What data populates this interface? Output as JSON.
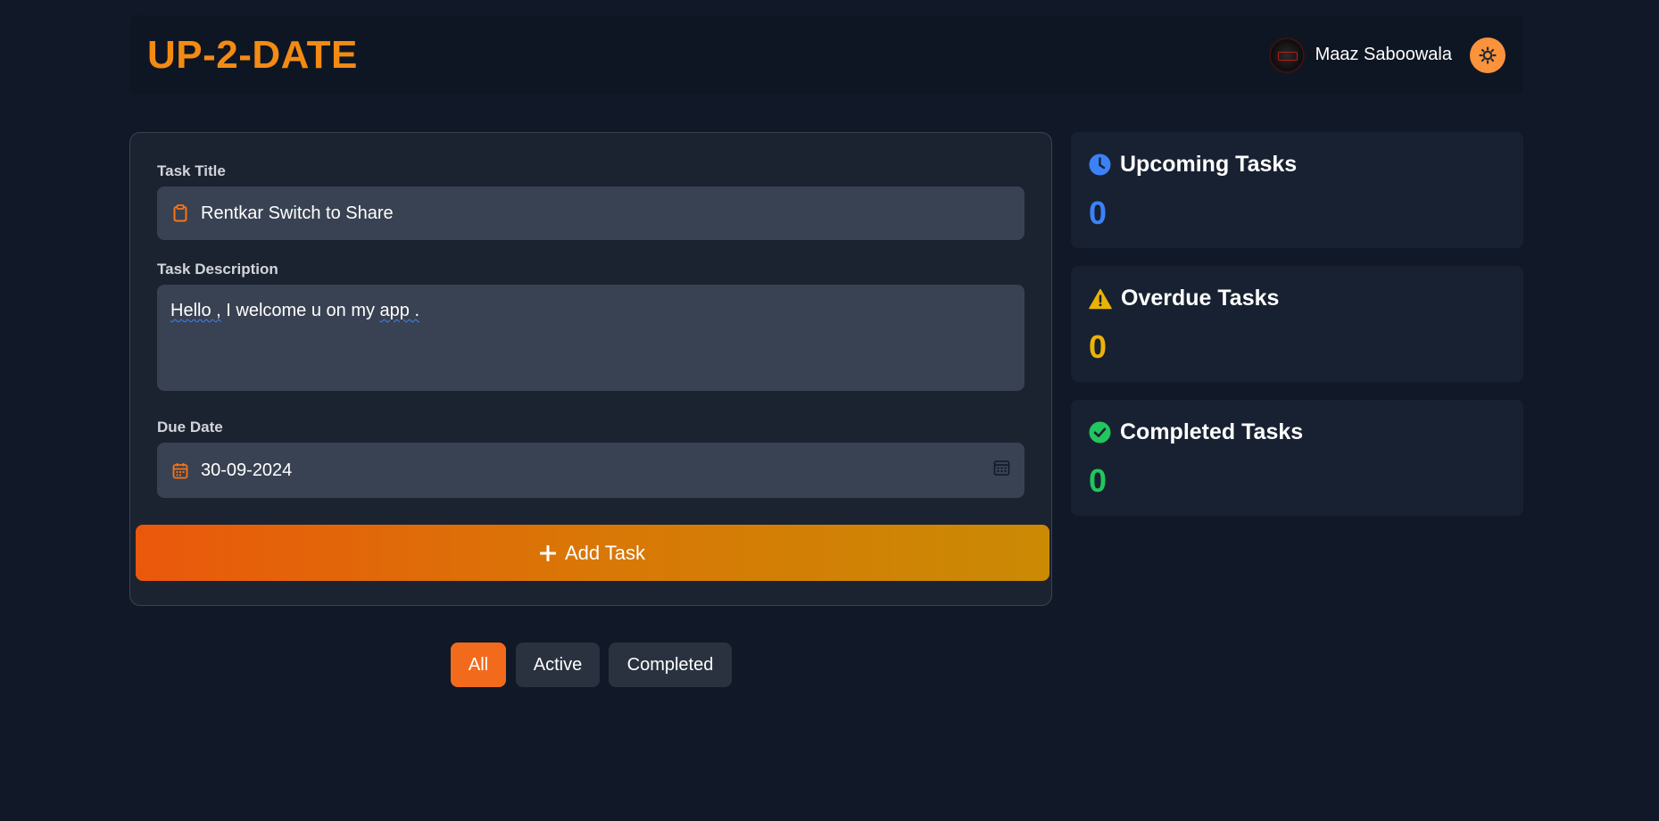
{
  "header": {
    "logo": "UP-2-DATE",
    "user_name": "Maaz Saboowala"
  },
  "form": {
    "title_label": "Task Title",
    "title_value": "Rentkar Switch to Share",
    "description_label": "Task Description",
    "description_value_parts": [
      "Hello ,",
      " I welcome u on my ",
      "app ."
    ],
    "due_label": "Due Date",
    "due_value": "30-09-2024",
    "add_button": "Add Task"
  },
  "filters": [
    {
      "label": "All",
      "active": true
    },
    {
      "label": "Active",
      "active": false
    },
    {
      "label": "Completed",
      "active": false
    }
  ],
  "stats": [
    {
      "title": "Upcoming Tasks",
      "value": "0",
      "color": "#3b82f6",
      "icon": "clock-icon"
    },
    {
      "title": "Overdue Tasks",
      "value": "0",
      "color": "#eab308",
      "icon": "warning-icon"
    },
    {
      "title": "Completed Tasks",
      "value": "0",
      "color": "#22c55e",
      "icon": "check-circle-icon"
    }
  ],
  "colors": {
    "accent": "#f38b13",
    "background": "#111827"
  }
}
